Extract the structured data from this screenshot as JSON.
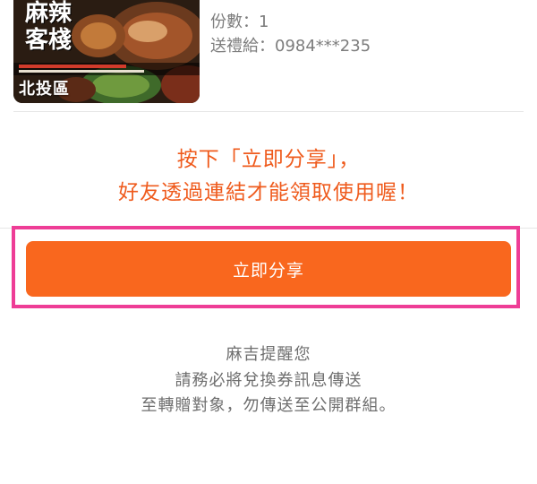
{
  "product": {
    "image_logo_text": "麻辣客棧",
    "image_region_tag": "北投區",
    "quantity_text": "份數：1",
    "recipient_text": "送禮給：0984***235"
  },
  "notice": {
    "line1": "按下「立即分享」，",
    "line2": "好友透過連結才能領取使用喔！",
    "color": "#ef5b1d"
  },
  "share_button": {
    "label": "立即分享",
    "color": "#f9671e"
  },
  "highlight_color": "#ee3d96",
  "reminder": {
    "line1": "麻吉提醒您",
    "line2": "請務必將兌換券訊息傳送",
    "line3": "至轉贈對象，勿傳送至公開群組。"
  }
}
